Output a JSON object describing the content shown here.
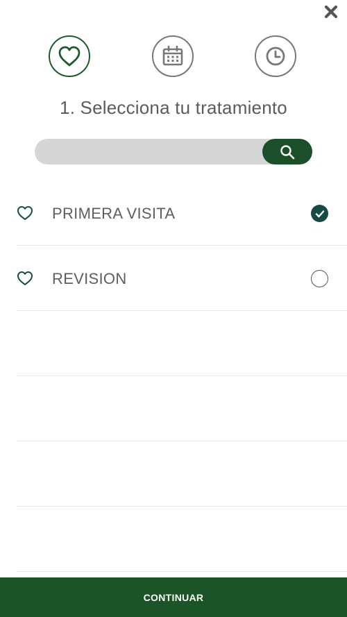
{
  "header": {
    "close_icon": "close-icon"
  },
  "steps": [
    {
      "icon": "heart-icon",
      "active": true
    },
    {
      "icon": "calendar-icon",
      "active": false
    },
    {
      "icon": "clock-icon",
      "active": false
    }
  ],
  "title": "1. Selecciona tu tratamiento",
  "search": {
    "placeholder": "",
    "value": "",
    "button_icon": "search-icon"
  },
  "treatments": [
    {
      "label": "PRIMERA VISITA",
      "icon": "heart-outline-icon",
      "selected": true
    },
    {
      "label": "REVISION",
      "icon": "heart-outline-icon",
      "selected": false
    }
  ],
  "footer": {
    "continue_label": "CONTINUAR"
  },
  "colors": {
    "accent": "#1b5527",
    "search_button": "#1b4f2a",
    "check": "#174a45",
    "search_bg": "#d6d6d6"
  }
}
